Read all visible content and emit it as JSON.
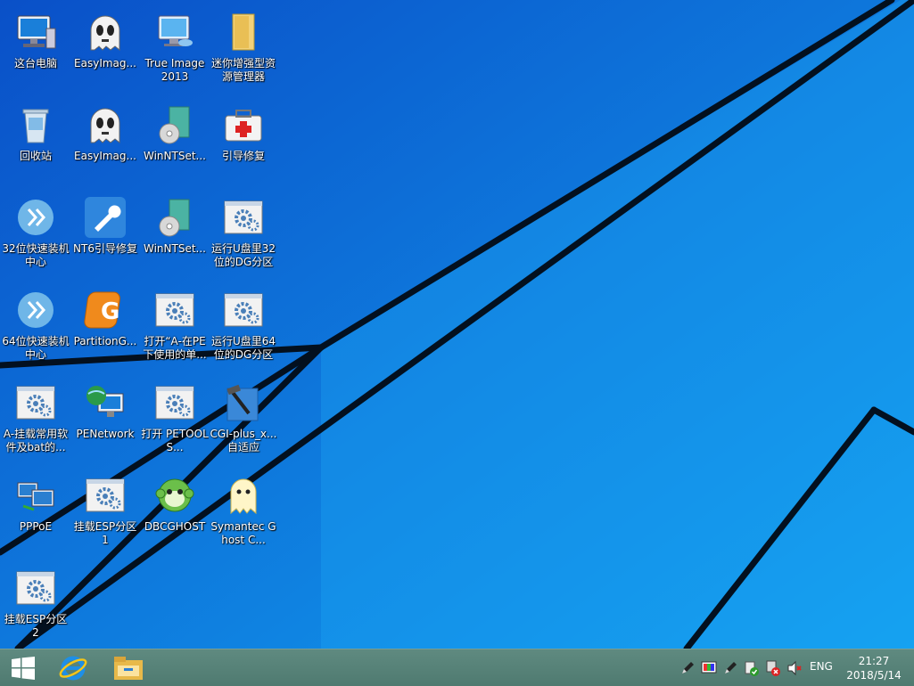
{
  "desktop": {
    "icons": [
      {
        "label": "这台电脑",
        "icon": "computer-icon"
      },
      {
        "label": "EasyImag...",
        "icon": "ghost-icon"
      },
      {
        "label": "True Image 2013",
        "icon": "monitor-icon"
      },
      {
        "label": "迷你增强型资源管理器",
        "icon": "folder-icon"
      },
      {
        "label": "回收站",
        "icon": "recycle-bin-icon"
      },
      {
        "label": "EasyImag...",
        "icon": "ghost-icon"
      },
      {
        "label": "WinNTSet...",
        "icon": "installer-disc-icon"
      },
      {
        "label": "引导修复",
        "icon": "first-aid-kit-icon"
      },
      {
        "label": "32位快速装机中心",
        "icon": "fast-forward-circle-icon"
      },
      {
        "label": "NT6引导修复",
        "icon": "wrench-icon"
      },
      {
        "label": "WinNTSet...",
        "icon": "installer-disc-icon"
      },
      {
        "label": "运行U盘里32位的DG分区",
        "icon": "script-gear-icon"
      },
      {
        "label": "64位快速装机中心",
        "icon": "fast-forward-circle-icon"
      },
      {
        "label": "PartitionG...",
        "icon": "partition-guru-icon"
      },
      {
        "label": "打开“A-在PE下使用的单...",
        "icon": "script-gear-icon"
      },
      {
        "label": "运行U盘里64位的DG分区",
        "icon": "script-gear-icon"
      },
      {
        "label": "A-挂载常用软件及bat的...",
        "icon": "script-gear-icon"
      },
      {
        "label": "PENetwork",
        "icon": "network-globe-icon"
      },
      {
        "label": "打开 PETOOLS...",
        "icon": "script-gear-icon"
      },
      {
        "label": "CGI-plus_x... 自适应",
        "icon": "cgi-tool-icon"
      },
      {
        "label": "PPPoE",
        "icon": "pppoe-computers-icon"
      },
      {
        "label": "挂载ESP分区 1",
        "icon": "script-gear-icon"
      },
      {
        "label": "DBCGHOST",
        "icon": "monkey-icon"
      },
      {
        "label": "Symantec Ghost C...",
        "icon": "ghost-yellow-icon"
      },
      {
        "label": "挂载ESP分区 2",
        "icon": "script-gear-icon"
      }
    ]
  },
  "taskbar": {
    "start": "windows-logo-icon",
    "pinned": [
      "internet-explorer-icon",
      "file-explorer-icon"
    ],
    "tray": [
      "pen-icon",
      "display-icon",
      "pen-icon",
      "shield-check-icon",
      "network-disconnected-icon",
      "speaker-muted-icon"
    ],
    "language": "ENG",
    "time": "21:27",
    "date": "2018/5/14"
  },
  "colors": {
    "taskbar": "#5a857b",
    "wallpaper_accent": "#1496ee"
  }
}
